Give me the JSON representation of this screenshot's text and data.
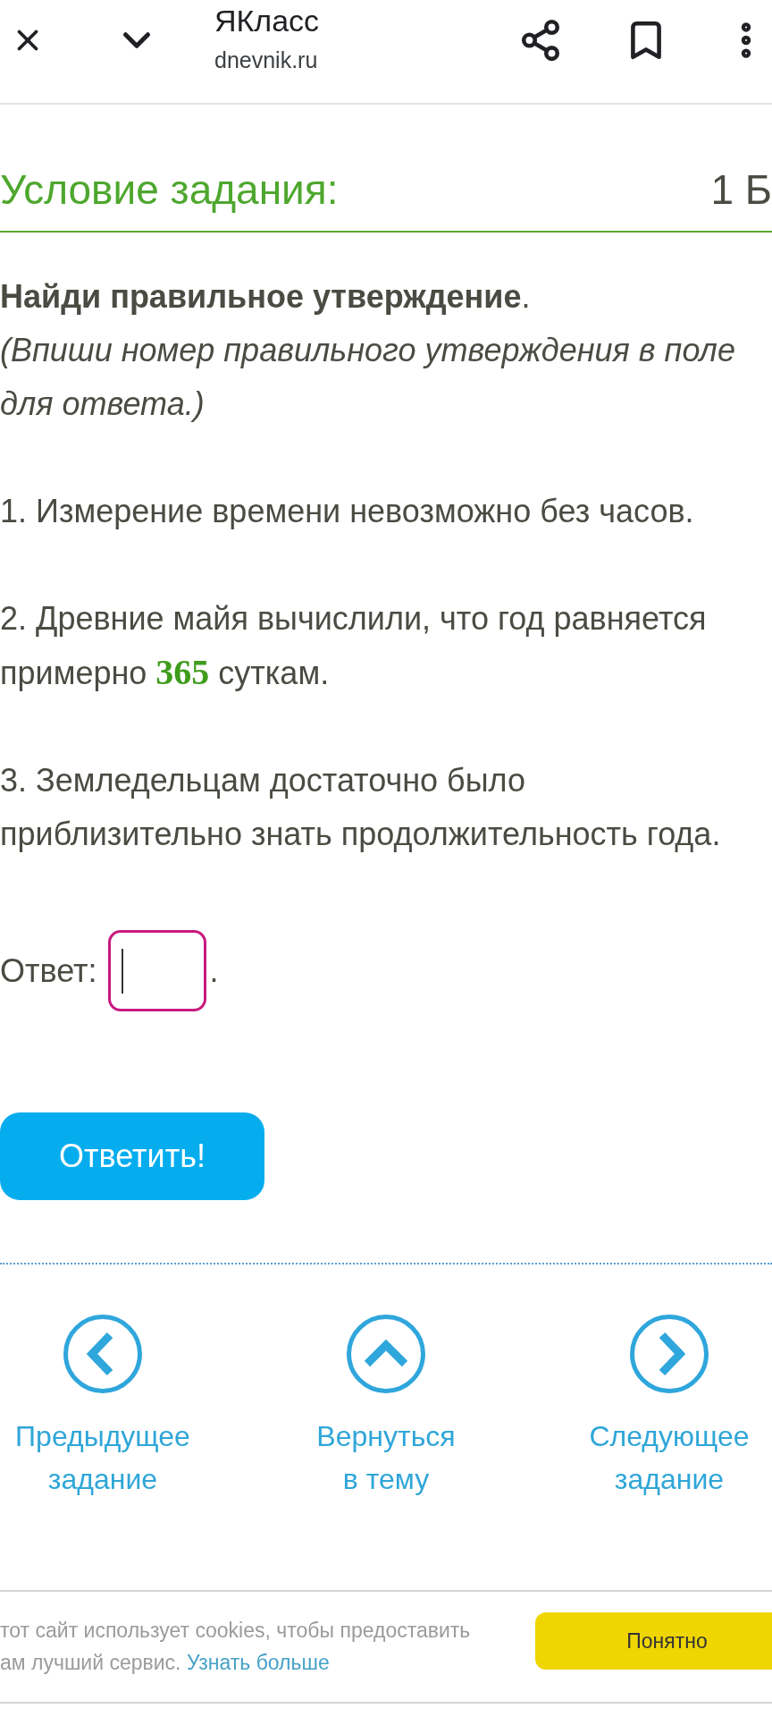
{
  "browser_bar": {
    "title": "ЯКласс",
    "url": "dnevnik.ru"
  },
  "task": {
    "heading": "Условие задания:",
    "points": "1 Б"
  },
  "instruction": "**Найди правильное утверждение**.",
  "hint": "(Впиши номер правильного утверждения в поле для ответа.)",
  "statements": [
    {
      "parts": [
        {
          "kind": "text",
          "text": "1. Измерение времени невозможно без часов."
        }
      ]
    },
    {
      "parts": [
        {
          "kind": "text",
          "text": "2. Древние майя вычислили, что год равняется примерно "
        },
        {
          "kind": "number",
          "text": "365"
        },
        {
          "kind": "text",
          "text": " суткам."
        }
      ]
    },
    {
      "parts": [
        {
          "kind": "text",
          "text": "3. Земледельцам достаточно было приблизительно знать продолжительность года."
        }
      ]
    }
  ],
  "answer": {
    "label": "Ответ:",
    "focused": true,
    "suffix": "."
  },
  "submit_button": "Ответить!",
  "navigation": [
    {
      "kind": "previous",
      "label": "Предыдущее задание"
    },
    {
      "kind": "up",
      "label": "Вернуться в тему"
    },
    {
      "kind": "next",
      "label": "Следующее задание"
    }
  ],
  "cookie_notice": {
    "text": "тот сайт использует cookies, чтобы предоставить ам лучший сервис.",
    "link": "Узнать больше",
    "button": "Понятно"
  }
}
